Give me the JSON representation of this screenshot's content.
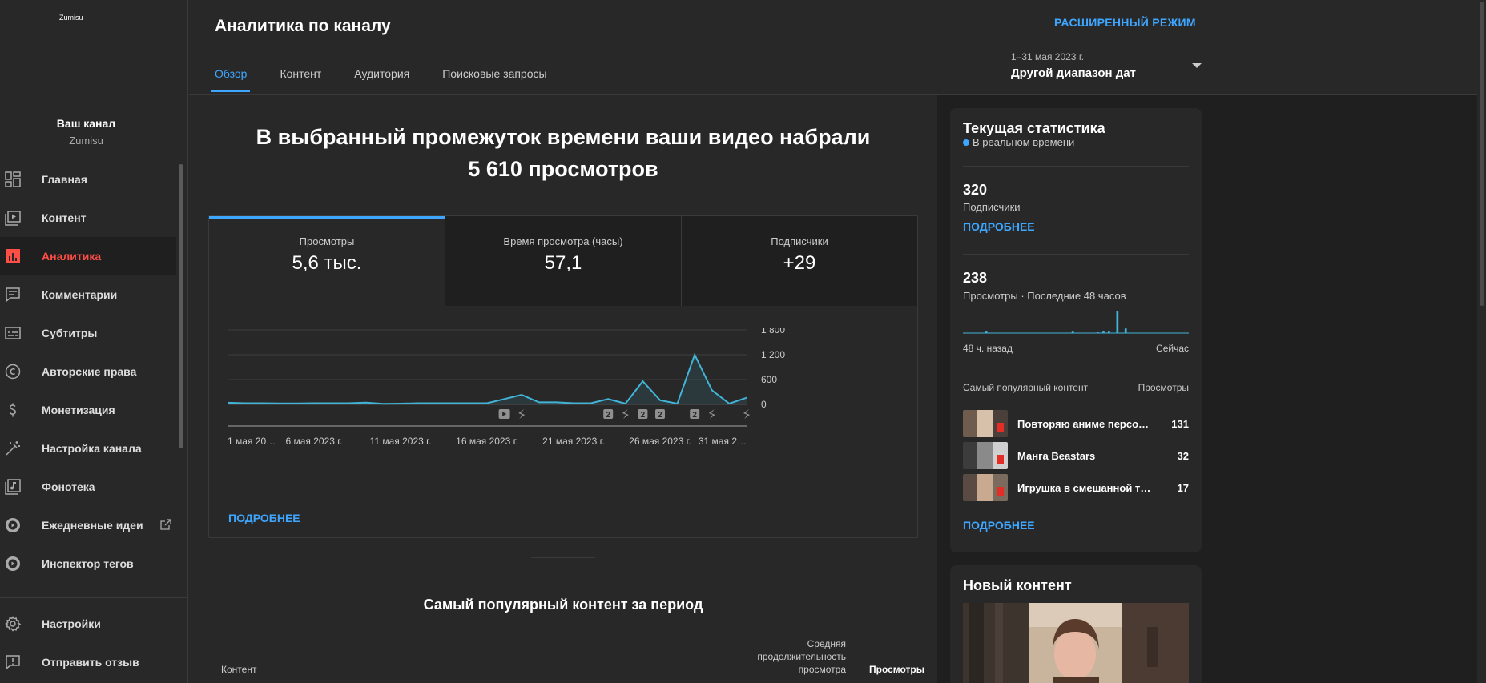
{
  "sidebar": {
    "logo_text": "Zumisu",
    "channel_title": "Ваш канал",
    "channel_handle": "Zumisu",
    "items": [
      {
        "label": "Главная",
        "icon": "dashboard-icon"
      },
      {
        "label": "Контент",
        "icon": "video-library-icon"
      },
      {
        "label": "Аналитика",
        "icon": "analytics-icon",
        "active": true
      },
      {
        "label": "Комментарии",
        "icon": "comments-icon"
      },
      {
        "label": "Субтитры",
        "icon": "subtitles-icon"
      },
      {
        "label": "Авторские права",
        "icon": "copyright-icon"
      },
      {
        "label": "Монетизация",
        "icon": "dollar-icon"
      },
      {
        "label": "Настройка канала",
        "icon": "magic-wand-icon"
      },
      {
        "label": "Фонотека",
        "icon": "audio-library-icon"
      },
      {
        "label": "Ежедневные идеи",
        "icon": "play-circle-icon",
        "external": true
      },
      {
        "label": "Инспектор тегов",
        "icon": "play-circle-icon"
      }
    ],
    "bottom_items": [
      {
        "label": "Настройки",
        "icon": "gear-icon"
      },
      {
        "label": "Отправить отзыв",
        "icon": "feedback-icon"
      }
    ]
  },
  "header": {
    "title": "Аналитика по каналу",
    "advanced_mode": "РАСШИРЕННЫЙ РЕЖИМ",
    "tabs": [
      {
        "label": "Обзор",
        "active": true
      },
      {
        "label": "Контент"
      },
      {
        "label": "Аудитория"
      },
      {
        "label": "Поисковые запросы"
      }
    ],
    "date_range": {
      "period": "1–31 мая 2023 г.",
      "label": "Другой диапазон дат"
    }
  },
  "overview": {
    "headline_line1": "В выбранный промежуток времени ваши видео набрали",
    "headline_line2": "5 610 просмотров",
    "metrics": [
      {
        "label": "Просмотры",
        "value": "5,6 тыс.",
        "active": true
      },
      {
        "label": "Время просмотра (часы)",
        "value": "57,1"
      },
      {
        "label": "Подписчики",
        "value": "+29"
      }
    ],
    "more_link": "ПОДРОБНЕЕ",
    "top_content_title": "Самый популярный контент за период",
    "table_headers": {
      "content": "Контент",
      "avg_line1": "Средняя",
      "avg_line2": "продолжительность",
      "avg_line3": "просмотра",
      "views": "Просмотры"
    }
  },
  "chart_data": {
    "type": "line",
    "series": [
      {
        "values": [
          40,
          30,
          30,
          25,
          25,
          30,
          30,
          30,
          45,
          15,
          20,
          30,
          30,
          30,
          30,
          30,
          130,
          230,
          50,
          50,
          30,
          30,
          130,
          20,
          560,
          100,
          20,
          1200,
          340,
          20,
          160
        ]
      }
    ],
    "x_start_day": 1,
    "x_tick_labels": [
      "1 мая 20…",
      "6 мая 2023 г.",
      "11 мая 2023 г.",
      "16 мая 2023 г.",
      "21 мая 2023 г.",
      "26 мая 2023 г.",
      "31 мая 2…"
    ],
    "x_tick_days": [
      1,
      6,
      11,
      16,
      21,
      26,
      31
    ],
    "y_ticks": [
      0,
      600,
      1200,
      1800
    ],
    "y_tick_labels": [
      "0",
      "600",
      "1 200",
      "1 800"
    ],
    "ylim": [
      0,
      1800
    ],
    "color": "#41b4d7",
    "markers": [
      {
        "day": 17,
        "kind": "video-icon"
      },
      {
        "day": 18,
        "kind": "shorts-icon"
      },
      {
        "day": 23,
        "kind": "count",
        "text": "2"
      },
      {
        "day": 24,
        "kind": "shorts-icon"
      },
      {
        "day": 25,
        "kind": "count",
        "text": "2"
      },
      {
        "day": 26,
        "kind": "count",
        "text": "2"
      },
      {
        "day": 28,
        "kind": "count",
        "text": "2"
      },
      {
        "day": 29,
        "kind": "shorts-icon"
      },
      {
        "day": 31,
        "kind": "shorts-icon"
      }
    ]
  },
  "realtime": {
    "title": "Текущая статистика",
    "live_label": "В реальном времени",
    "subscribers_value": "320",
    "subscribers_label": "Подписчики",
    "more_link": "ПОДРОБНЕЕ",
    "views_value": "238",
    "views_label": "Просмотры · Последние 48 часов",
    "mini_chart": [
      0,
      0,
      0,
      0,
      0,
      0,
      0,
      0,
      2,
      0,
      0,
      0,
      0,
      0,
      0,
      0,
      0,
      0,
      0,
      0,
      0,
      0,
      0,
      0,
      0,
      0,
      0,
      0,
      0,
      0,
      0,
      0,
      0,
      0,
      0,
      0,
      0,
      0,
      0,
      2,
      0,
      0,
      0,
      0,
      0,
      0,
      0,
      0,
      1,
      0,
      2,
      0,
      2,
      0,
      0,
      28,
      0,
      0,
      6,
      0,
      0,
      0,
      0,
      0,
      0,
      0,
      0,
      0,
      0,
      0,
      0,
      0,
      0,
      0,
      0,
      0,
      0,
      0,
      0,
      0,
      0
    ],
    "mini_start": "48 ч. назад",
    "mini_end": "Сейчас",
    "top_header_left": "Самый популярный контент",
    "top_header_right": "Просмотры",
    "top_items": [
      {
        "title": "Повторяю аниме персона…",
        "views": "131"
      },
      {
        "title": "Манга Beastars",
        "views": "32"
      },
      {
        "title": "Игрушка в смешанной тех…",
        "views": "17"
      }
    ],
    "more_link_2": "ПОДРОБНЕЕ"
  },
  "new_content": {
    "title": "Новый контент"
  }
}
